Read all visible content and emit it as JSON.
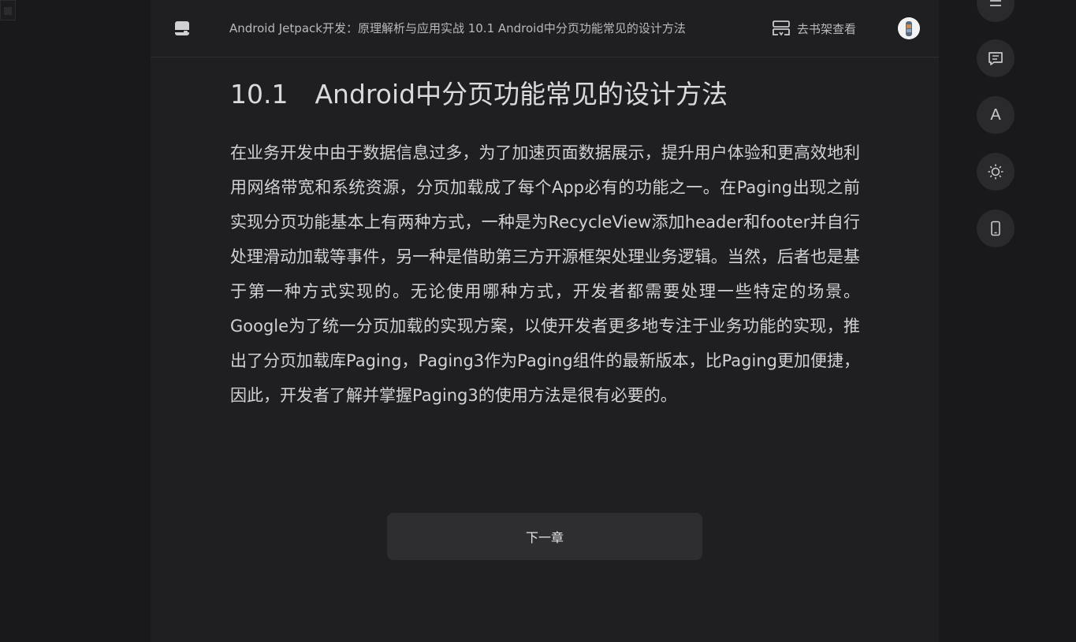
{
  "header": {
    "title": "Android Jetpack开发：原理解析与应用实战 10.1 Android中分页功能常见的设计方法",
    "shelf_label": "去书架查看",
    "icons": {
      "book": "book-icon",
      "shelf": "bookshelf-icon",
      "avatar": "user-avatar"
    }
  },
  "chapter": {
    "number": "10.1",
    "title": "Android中分页功能常见的设计方法",
    "paragraph": "在业务开发中由于数据信息过多，为了加速页面数据展示，提升用户体验和更高效地利用网络带宽和系统资源，分页加载成了每个App必有的功能之一。在Paging出现之前实现分页功能基本上有两种方式，一种是为RecycleView添加header和footer并自行处理滑动加载等事件，另一种是借助第三方开源框架处理业务逻辑。当然，后者也是基于第一种方式实现的。无论使用哪种方式，开发者都需要处理一些特定的场景。Google为了统一分页加载的实现方案，以使开发者更多地专注于业务功能的实现，推出了分页加载库Paging，Paging3作为Paging组件的最新版本，比Paging更加便捷，因此，开发者了解并掌握Paging3的使用方法是很有必要的。"
  },
  "navigation": {
    "next_label": "下一章"
  },
  "side_tools": {
    "menu_icon": "menu-icon",
    "notes_icon": "notes-icon",
    "font_label": "A",
    "brightness_icon": "brightness-icon",
    "device_icon": "phone-icon"
  },
  "colors": {
    "page_bg": "#19191b",
    "reader_bg": "#1f1f21",
    "text": "#d2d2d6",
    "button_bg": "#2e2e31"
  }
}
